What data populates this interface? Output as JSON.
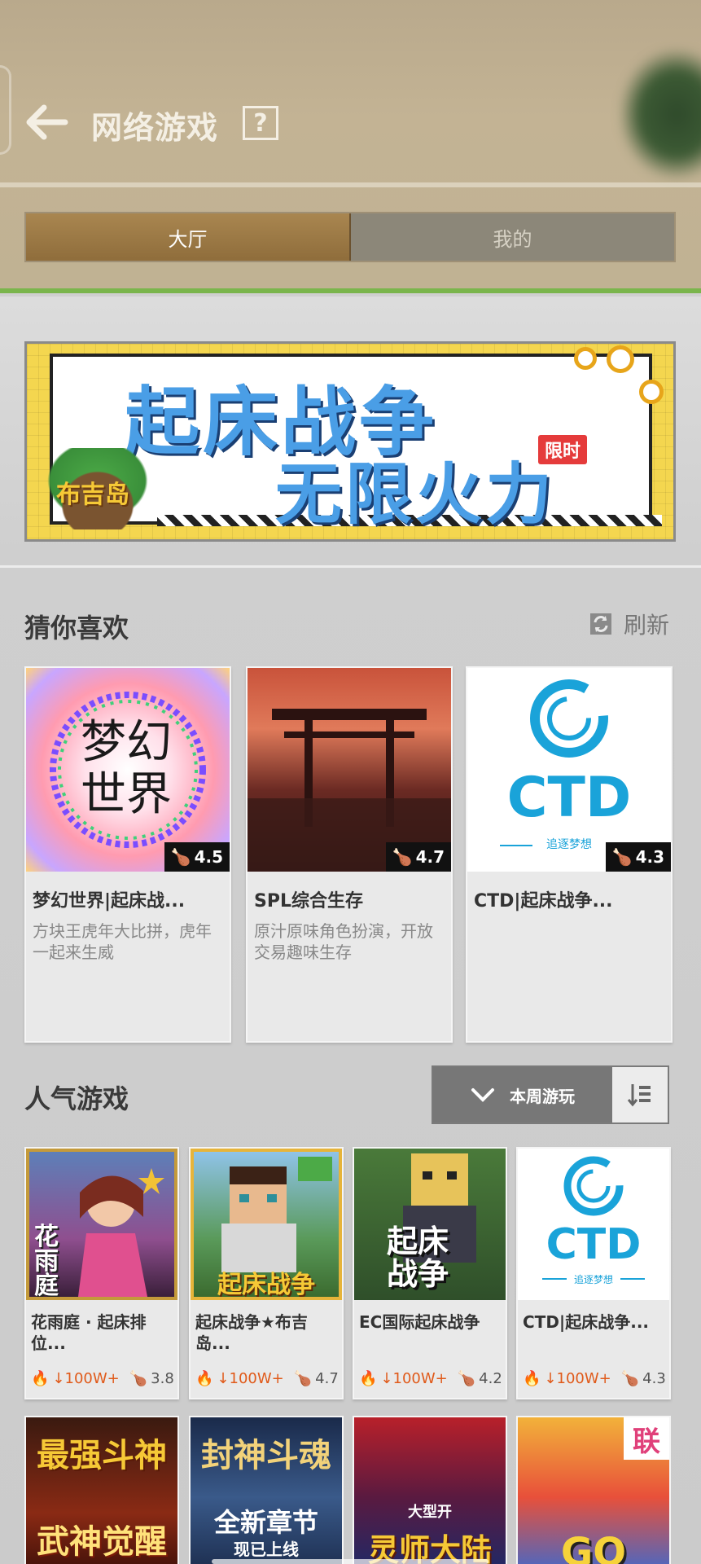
{
  "header": {
    "title": "网络游戏",
    "help_symbol": "?",
    "tabs": [
      {
        "label": "大厅",
        "active": true
      },
      {
        "label": "我的",
        "active": false
      }
    ]
  },
  "banner": {
    "line1": "起床战争",
    "line2": "无限火力",
    "tag": "限时",
    "logo_text": "布吉岛"
  },
  "recommend": {
    "title": "猜你喜欢",
    "refresh_label": "刷新",
    "items": [
      {
        "name": "梦幻世界|起床战...",
        "desc": "方块王虎年大比拼，虎年一起来生威",
        "rating": "4.5",
        "art_text": "梦幻世界"
      },
      {
        "name": "SPL综合生存",
        "desc": "原汁原味角色扮演，开放交易趣味生存",
        "rating": "4.7",
        "art_text": ""
      },
      {
        "name": "CTD|起床战争...",
        "desc": "",
        "rating": "4.3",
        "art_text": "CTD",
        "art_sub": "追逐梦想"
      }
    ]
  },
  "popular": {
    "title": "人气游戏",
    "sort_label": "本周游玩",
    "items": [
      {
        "name": "花雨庭 · 起床排位...",
        "plays": "↓100W+",
        "rating": "3.8",
        "art_text": "花雨庭"
      },
      {
        "name": "起床战争★布吉岛...",
        "plays": "↓100W+",
        "rating": "4.7",
        "art_text": "起床战争"
      },
      {
        "name": "EC国际起床战争",
        "plays": "↓100W+",
        "rating": "4.2",
        "art_text": "起床战争"
      },
      {
        "name": "CTD|起床战争...",
        "plays": "↓100W+",
        "rating": "4.3",
        "art_text": "CTD",
        "art_sub": "追逐梦想"
      }
    ],
    "more": [
      {
        "art_top": "最强斗神",
        "art_bottom": "武神觉醒"
      },
      {
        "art_top": "封神斗魂",
        "art_bottom": "全新章节",
        "art_sub": "现已上线"
      },
      {
        "art_top": "大型开",
        "art_bottom": "灵师大陆"
      },
      {
        "art_top": "联",
        "art_bottom": "GO"
      }
    ]
  },
  "colors": {
    "accent_green": "#7ab54c",
    "tab_active": "#a98650",
    "ctd_blue": "#1aa3d9",
    "plays_orange": "#e05a1a"
  }
}
